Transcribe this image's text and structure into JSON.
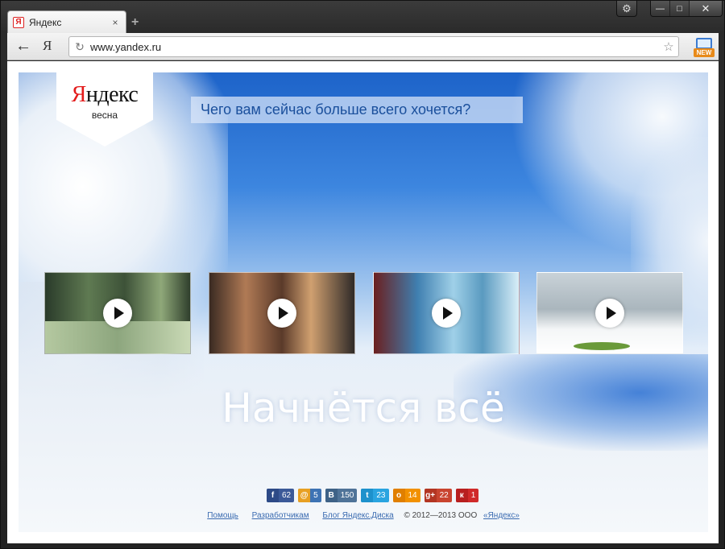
{
  "tab": {
    "title": "Яндекс",
    "favicon": "Я",
    "close": "×",
    "new_tab": "+"
  },
  "window": {
    "settings_icon": "gear-icon",
    "minimize": "—",
    "maximize": "□",
    "close": "✕"
  },
  "toolbar": {
    "back": "←",
    "yandex_button": "Я",
    "url": "www.yandex.ru",
    "reload": "↻",
    "star": "☆",
    "new_badge": "NEW"
  },
  "page": {
    "logo": {
      "ya": "Я",
      "rest": "ндекс",
      "subtitle": "весна"
    },
    "question": "Чего вам сейчас больше всего хочется?",
    "videos": [
      {
        "name": "winter forest"
      },
      {
        "name": "cafe"
      },
      {
        "name": "ice"
      },
      {
        "name": "girl in snow"
      }
    ],
    "slogan": "Начнётся всё",
    "shares": [
      {
        "network": "facebook",
        "icon": "f",
        "count": "62",
        "color": "#3b5998",
        "icon_bg": "#2d4a87"
      },
      {
        "network": "mailru",
        "icon": "@",
        "count": "5",
        "color": "#3d73b4",
        "icon_bg": "#e8a022"
      },
      {
        "network": "vkontakte",
        "icon": "В",
        "count": "150",
        "color": "#4f7398",
        "icon_bg": "#3e6287"
      },
      {
        "network": "twitter",
        "icon": "t",
        "count": "23",
        "color": "#2aa4e0",
        "icon_bg": "#1d91cc"
      },
      {
        "network": "odnoklassniki",
        "icon": "о",
        "count": "14",
        "color": "#f29100",
        "icon_bg": "#e07f00"
      },
      {
        "network": "googleplus",
        "icon": "g+",
        "count": "22",
        "color": "#c9442f",
        "icon_bg": "#b33522"
      },
      {
        "network": "moikrug",
        "icon": "к",
        "count": "1",
        "color": "#d02a2a",
        "icon_bg": "#b81f1f"
      }
    ],
    "footer": {
      "help": "Помощь",
      "developers": "Разработчикам",
      "blog": "Блог Яндекс.Диска",
      "copyright": "© 2012—2013 ООО",
      "company": "«Яндекс»"
    }
  }
}
